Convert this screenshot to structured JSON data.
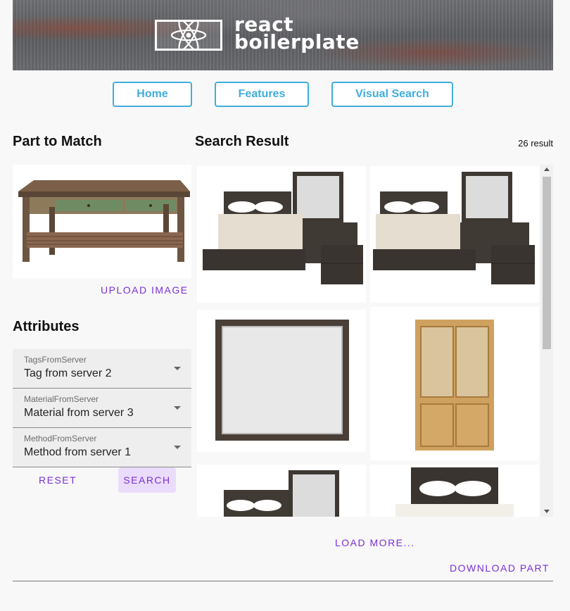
{
  "header": {
    "logo_line1": "react",
    "logo_line2": "boilerplate"
  },
  "nav": {
    "home": "Home",
    "features": "Features",
    "visual_search": "Visual Search"
  },
  "part": {
    "title": "Part to Match",
    "upload_label": "UPLOAD IMAGE"
  },
  "attributes": {
    "title": "Attributes",
    "tags": {
      "label": "TagsFromServer",
      "value": "Tag from server 2"
    },
    "material": {
      "label": "MaterialFromServer",
      "value": "Material from server 3"
    },
    "method": {
      "label": "MethodFromServer",
      "value": "Method from server 1"
    },
    "reset_label": "RESET",
    "search_label": "SEARCH"
  },
  "results": {
    "title": "Search Result",
    "count": "26 result",
    "items": [
      "bedroom-set",
      "bedroom-set",
      "mirror",
      "cabinet",
      "bedroom-set",
      "bed"
    ],
    "load_more": "LOAD MORE..."
  },
  "footer": {
    "download_label": "DOWNLOAD PART"
  },
  "colors": {
    "nav_accent": "#41addd",
    "action_purple": "#7b2fd6",
    "search_bg": "#eadcfb"
  }
}
